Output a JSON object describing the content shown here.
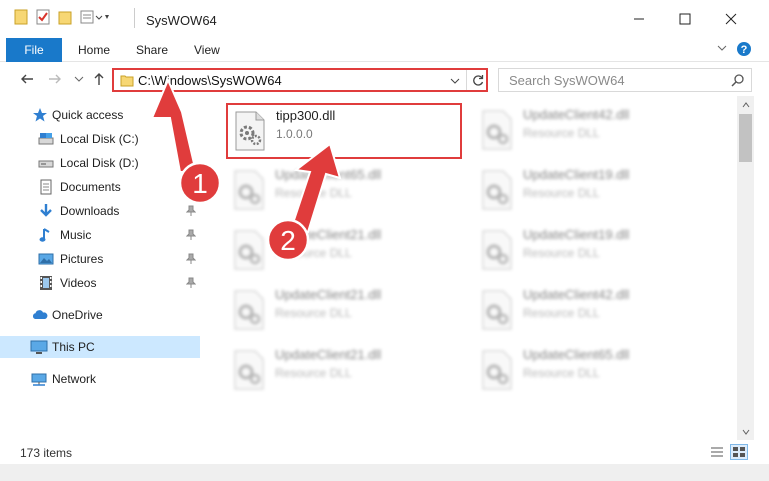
{
  "window": {
    "title": "SysWOW64",
    "minimize_glyph": "—",
    "maximize_glyph": "☐",
    "close_glyph": "✕"
  },
  "ribbon": {
    "tabs": [
      "File",
      "Home",
      "Share",
      "View"
    ],
    "help_glyph": "?"
  },
  "address": {
    "path": "C:\\Windows\\SysWOW64",
    "search_placeholder": "Search SysWOW64"
  },
  "sidebar": {
    "items": [
      {
        "label": "Quick access",
        "icon": "star-icon",
        "pinned": false
      },
      {
        "label": "Local Disk (C:)",
        "icon": "drive-icon",
        "pinned": false
      },
      {
        "label": "Local Disk (D:)",
        "icon": "drive-icon",
        "pinned": false
      },
      {
        "label": "Documents",
        "icon": "document-icon",
        "pinned": true
      },
      {
        "label": "Downloads",
        "icon": "download-icon",
        "pinned": true
      },
      {
        "label": "Music",
        "icon": "music-icon",
        "pinned": true
      },
      {
        "label": "Pictures",
        "icon": "picture-icon",
        "pinned": true
      },
      {
        "label": "Videos",
        "icon": "video-icon",
        "pinned": true
      },
      {
        "label": "OneDrive",
        "icon": "cloud-icon",
        "pinned": false
      },
      {
        "label": "This PC",
        "icon": "computer-icon",
        "pinned": false,
        "selected": true
      },
      {
        "label": "Network",
        "icon": "network-icon",
        "pinned": false
      }
    ]
  },
  "files": [
    {
      "name": "tipp300.dll",
      "sub": "1.0.0.0",
      "highlighted": true
    },
    {
      "name": "UpdateClient42.dll",
      "sub": "Resource DLL"
    },
    {
      "name": "UpdateClient65.dll",
      "sub": "Resource DLL"
    },
    {
      "name": "UpdateClient19.dll",
      "sub": "Resource DLL"
    },
    {
      "name": "UpdateClient21.dll",
      "sub": "Resource DLL"
    },
    {
      "name": "UpdateClient19.dll",
      "sub": "Resource DLL"
    },
    {
      "name": "UpdateClient21.dll",
      "sub": "Resource DLL"
    },
    {
      "name": "UpdateClient42.dll",
      "sub": "Resource DLL"
    },
    {
      "name": "UpdateClient21.dll",
      "sub": "Resource DLL"
    },
    {
      "name": "UpdateClient65.dll",
      "sub": "Resource DLL"
    }
  ],
  "status": {
    "item_count": "173 items"
  },
  "annotations": {
    "step1": "1",
    "step2": "2",
    "color": "#e03c3c"
  },
  "colors": {
    "accent": "#1979ca",
    "selection": "#cce8ff"
  }
}
